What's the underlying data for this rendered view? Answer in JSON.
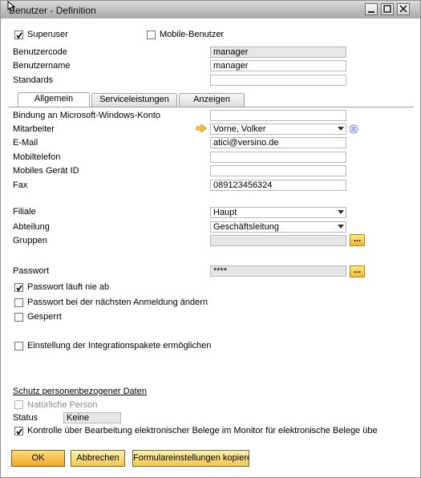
{
  "window": {
    "title": "Benutzer - Definition"
  },
  "header": {
    "superuser_label": "Superuser",
    "superuser_checked": true,
    "mobile_user_label": "Mobile-Benutzer",
    "mobile_user_checked": false,
    "user_code_label": "Benutzercode",
    "user_code_value": "manager",
    "user_name_label": "Benutzername",
    "user_name_value": "manager",
    "defaults_label": "Standards",
    "defaults_value": ""
  },
  "tabs": [
    {
      "label": "Allgemein",
      "active": true
    },
    {
      "label": "Serviceleistungen",
      "active": false
    },
    {
      "label": "Anzeigen",
      "active": false
    }
  ],
  "general": {
    "ms_account_label": "Bindung an Microsoft-Windows-Konto",
    "ms_account_value": "",
    "employee_label": "Mitarbeiter",
    "employee_value": "Vorne, Volker",
    "email_label": "E-Mail",
    "email_value": "atici@versino.de",
    "mobile_label": "Mobiltelefon",
    "mobile_value": "",
    "mobile_device_label": "Mobiles Gerät ID",
    "mobile_device_value": "",
    "fax_label": "Fax",
    "fax_value": "089123456324",
    "branch_label": "Filiale",
    "branch_value": "Haupt",
    "department_label": "Abteilung",
    "department_value": "Geschäftsleitung",
    "groups_label": "Gruppen",
    "groups_value": "",
    "password_label": "Passwort",
    "password_value": "****",
    "never_expires_label": "Passwort läuft nie ab",
    "never_expires_checked": true,
    "change_next_login_label": "Passwort bei der nächsten Anmeldung ändern",
    "change_next_login_checked": false,
    "locked_label": "Gesperrt",
    "locked_checked": false,
    "integration_label": "Einstellung der Integrationspakete ermöglichen",
    "integration_checked": false
  },
  "privacy": {
    "section_title": "Schutz personenbezogener Daten",
    "natural_person_label": "Natürliche Person",
    "natural_person_checked": false,
    "status_label": "Status",
    "status_value": "Keine",
    "monitor_label": "Kontrolle über Bearbeitung elektronischer Belege im Monitor für elektronische Belege überne",
    "monitor_checked": true
  },
  "footer": {
    "ok_label": "OK",
    "cancel_label": "Abbrechen",
    "copy_form_settings_label": "Formulareinstellungen kopiere"
  },
  "icons": {
    "link_arrow": "link-arrow-icon",
    "info": "info-icon",
    "ellipsis": "..."
  },
  "colors": {
    "accent_button": "#f3c64e",
    "link_arrow": "#e8b020",
    "readonly_field": "#e6e6e6"
  }
}
